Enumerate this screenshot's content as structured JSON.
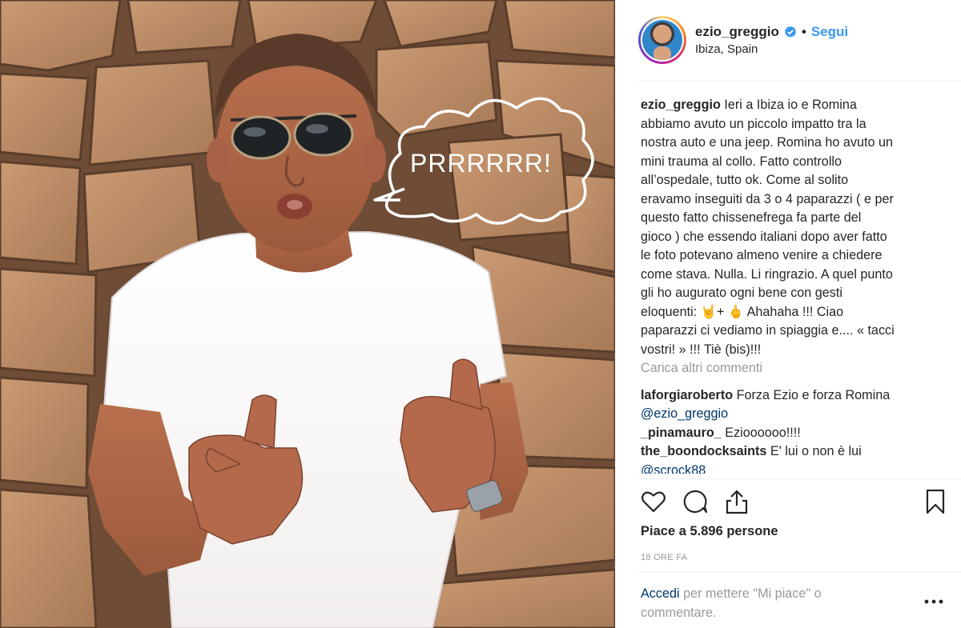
{
  "post": {
    "username": "ezio_greggio",
    "separator": "•",
    "follow_label": "Segui",
    "location": "Ibiza, Spain",
    "sticker_text": "PRRRRRR!",
    "caption_username": "ezio_greggio",
    "caption_lines": [
      "Ieri a Ibiza io e Romina",
      "abbiamo avuto un piccolo impatto tra la",
      "nostra auto e una jeep. Romina ho avuto un",
      "mini trauma al collo. Fatto controllo",
      "all’ospedale, tutto ok. Come al solito",
      "eravamo inseguiti da 3 o 4 paparazzi ( e per",
      "questo fatto chissenefrega fa parte del",
      "gioco ) che essendo italiani dopo aver fatto",
      "le foto potevano almeno venire a chiedere",
      "come stava. Nulla. Li ringrazio. A quel punto",
      "gli ho augurato ogni bene con gesti",
      "eloquenti: 🤘+ 🖕 Ahahaha !!! Ciao",
      "paparazzi ci vediamo in spiaggia e.... « tacci",
      "vostri! » !!! Tiè (bis)!!!"
    ],
    "load_more_label": "Carica altri commenti",
    "comments": [
      {
        "username": "laforgiaroberto",
        "text": "Forza Ezio e forza Romina",
        "mention": "@ezio_greggio"
      },
      {
        "username": "_pinamauro_",
        "text": "Ezioooooo!!!!"
      },
      {
        "username": "the_boondocksaints",
        "text": "E' lui o non è lui",
        "mention": "@scrock88"
      }
    ],
    "likes_text": "Piace a 5.896 persone",
    "timestamp": "18 ORE FA",
    "login_link": "Accedi",
    "login_text": "per mettere \"Mi piace\" o commentare.",
    "icons": {
      "like": "heart-icon",
      "comment": "comment-bubble-icon",
      "share": "share-icon",
      "save": "bookmark-icon",
      "verified": "verified-badge-icon",
      "more": "more-options-icon"
    },
    "colors": {
      "link_blue": "#3897f0",
      "mention_blue": "#003569",
      "muted_gray": "#999999",
      "text": "#262626"
    }
  }
}
